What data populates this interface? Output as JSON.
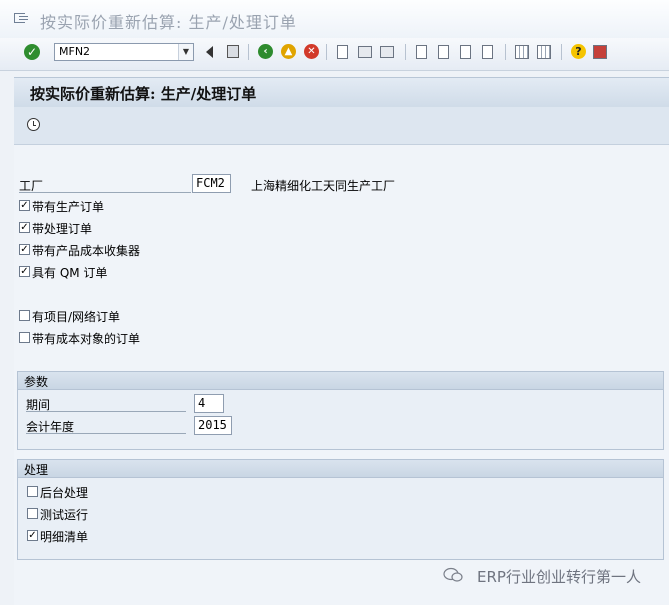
{
  "window": {
    "title": "按实际价重新估算: 生产/处理订单"
  },
  "toolbar": {
    "command_value": "MFN2"
  },
  "header": {
    "title": "按实际价重新估算: 生产/处理订单"
  },
  "selection": {
    "plant_label": "工厂",
    "plant_value": "FCM2",
    "plant_desc": "上海精细化工天同生产工厂",
    "checkboxes": [
      {
        "label": "带有生产订单",
        "checked": true
      },
      {
        "label": "带处理订单",
        "checked": true
      },
      {
        "label": "带有产品成本收集器",
        "checked": true
      },
      {
        "label": "具有 QM 订单",
        "checked": true
      },
      {
        "label": "有项目/网络订单",
        "checked": false
      },
      {
        "label": "带有成本对象的订单",
        "checked": false
      }
    ]
  },
  "parameters": {
    "title": "参数",
    "period_label": "期间",
    "period_value": "4",
    "year_label": "会计年度",
    "year_value": "2015"
  },
  "processing": {
    "title": "处理",
    "options": [
      {
        "label": "后台处理",
        "checked": false
      },
      {
        "label": "测试运行",
        "checked": false
      },
      {
        "label": "明细清单",
        "checked": true
      }
    ]
  },
  "watermark": {
    "text": "ERP行业创业转行第一人"
  }
}
